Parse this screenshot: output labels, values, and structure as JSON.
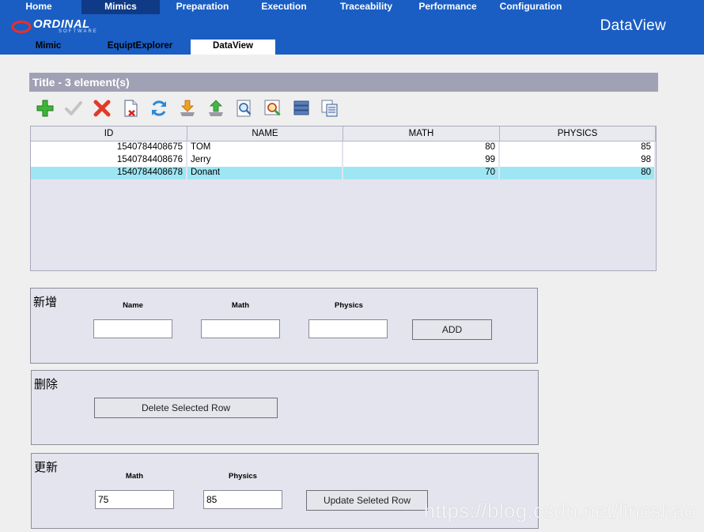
{
  "top_nav": [
    {
      "label": "Home"
    },
    {
      "label": "Mimics"
    },
    {
      "label": "Preparation"
    },
    {
      "label": "Execution"
    },
    {
      "label": "Traceability"
    },
    {
      "label": "Performance"
    },
    {
      "label": "Configuration"
    }
  ],
  "brand": {
    "name": "ORDINAL",
    "tagline": "SOFTWARE"
  },
  "app_title": "DataView",
  "sub_nav": [
    {
      "label": "Mimic"
    },
    {
      "label": "EquiptExplorer"
    },
    {
      "label": "DataView"
    }
  ],
  "panel": {
    "title": "Title - 3 element(s)"
  },
  "toolbar": {
    "icons": [
      "add-icon",
      "confirm-icon",
      "delete-icon",
      "delete-document-icon",
      "refresh-icon",
      "download-icon",
      "upload-icon",
      "search-icon",
      "search-image-icon",
      "database-icon",
      "copy-icon"
    ]
  },
  "table": {
    "columns": [
      "ID",
      "NAME",
      "MATH",
      "PHYSICS"
    ],
    "rows": [
      {
        "id": "1540784408675",
        "name": "TOM",
        "math": "80",
        "physics": "85"
      },
      {
        "id": "1540784408676",
        "name": "Jerry",
        "math": "99",
        "physics": "98"
      },
      {
        "id": "1540784408678",
        "name": "Donant",
        "math": "70",
        "physics": "80"
      }
    ],
    "selected_row": 2
  },
  "add_form": {
    "title": "新增",
    "name_label": "Name",
    "math_label": "Math",
    "physics_label": "Physics",
    "name_value": "",
    "math_value": "",
    "physics_value": "",
    "button": "ADD"
  },
  "delete_form": {
    "title": "删除",
    "button": "Delete Selected Row"
  },
  "update_form": {
    "title": "更新",
    "math_label": "Math",
    "physics_label": "Physics",
    "math_value": "75",
    "physics_value": "85",
    "button": "Update Seleted Row"
  },
  "watermark": "https://blog.csdn.net/lincshao",
  "colors": {
    "header_bg": "#1a5ec4",
    "nav_active": "#0f3a86",
    "panel_title_bg": "#a1a1b5",
    "selected_row": "#9ee6f3",
    "form_bg": "#e3e4ee"
  }
}
